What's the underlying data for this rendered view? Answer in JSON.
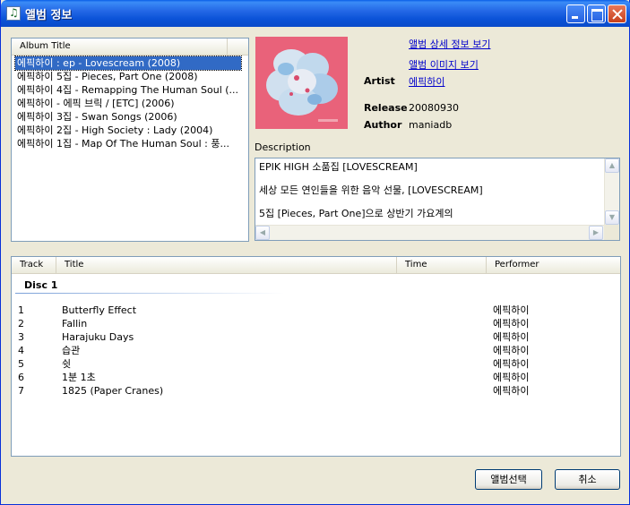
{
  "window": {
    "title": "앨범 정보"
  },
  "album_list": {
    "column": "Album Title",
    "items": [
      "에픽하이 : ep - Lovescream (2008)",
      "에픽하이 5집 - Pieces, Part One (2008)",
      "에픽하이 4집 - Remapping The Human Soul (...",
      "에픽하이 - 에픽 브릭 / [ETC] (2006)",
      "에픽하이 3집 - Swan Songs (2006)",
      "에픽하이 2집 - High Society : Lady (2004)",
      "에픽하이 1집 - Map Of The Human Soul : 풍..."
    ],
    "selected_index": 0
  },
  "info": {
    "link_detail": "앨범 상세 정보 보기",
    "link_image": "앨범 이미지 보기",
    "artist_label": "Artist",
    "artist_value": "에픽하이",
    "release_label": "Release",
    "release_value": "20080930",
    "author_label": "Author",
    "author_value": "maniadb",
    "description_label": "Description",
    "description": [
      "EPIK HIGH 소품집 [LOVESCREAM]",
      "세상 모든 연인들을 위한 음악 선물, [LOVESCREAM]",
      "5집 [Pieces, Part One]으로 상반기 가요계의"
    ]
  },
  "tracks": {
    "columns": {
      "track": "Track",
      "title": "Title",
      "time": "Time",
      "performer": "Performer"
    },
    "disc": "Disc 1",
    "rows": [
      {
        "no": "1",
        "title": "Butterfly Effect",
        "time": "",
        "performer": "에픽하이"
      },
      {
        "no": "2",
        "title": "Fallin",
        "time": "",
        "performer": "에픽하이"
      },
      {
        "no": "3",
        "title": "Harajuku Days",
        "time": "",
        "performer": "에픽하이"
      },
      {
        "no": "4",
        "title": "습관",
        "time": "",
        "performer": "에픽하이"
      },
      {
        "no": "5",
        "title": "쉿",
        "time": "",
        "performer": "에픽하이"
      },
      {
        "no": "6",
        "title": "1분 1초",
        "time": "",
        "performer": "에픽하이"
      },
      {
        "no": "7",
        "title": "1825 (Paper Cranes)",
        "time": "",
        "performer": "에픽하이"
      }
    ]
  },
  "buttons": {
    "select": "앨범선택",
    "cancel": "취소"
  },
  "colors": {
    "selection": "#316ac5",
    "titlebar": "#0a5fe8",
    "link": "#0000cc",
    "cover": "#e9627a"
  }
}
